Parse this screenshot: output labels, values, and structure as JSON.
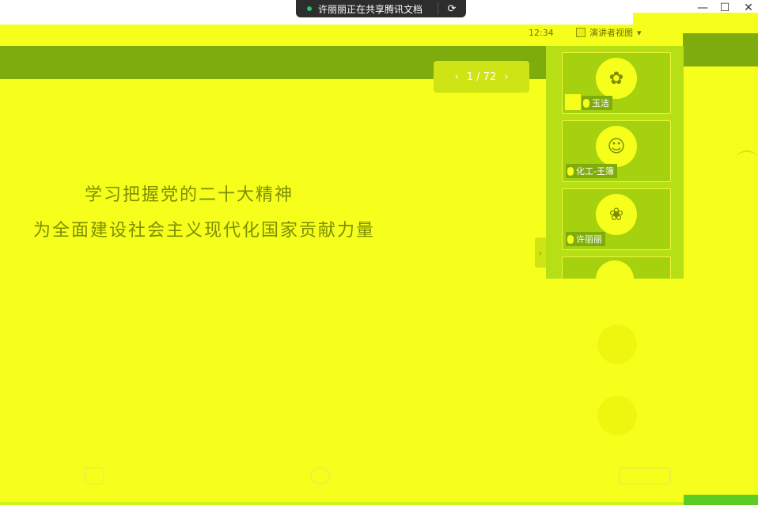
{
  "share_banner": {
    "text": "许丽丽正在共享腾讯文档"
  },
  "window_controls": {
    "minimize": "—",
    "maximize": "☐",
    "close": "✕"
  },
  "header": {
    "time": "12:34",
    "speaker_view": "演讲者视图"
  },
  "pager": {
    "prev": "‹",
    "label": "1 / 72",
    "next": "›"
  },
  "slide": {
    "line1": "学习把握党的二十大精神",
    "line2": "为全面建设社会主义现代化国家贡献力量"
  },
  "participants": [
    {
      "name": "玉洁"
    },
    {
      "name": "化工-王簿"
    },
    {
      "name": "许丽丽"
    }
  ],
  "colors": {
    "background": "#f6ff1c",
    "header": "#7fac0d",
    "panel": "#b6df16",
    "text": "#7d8f00"
  }
}
